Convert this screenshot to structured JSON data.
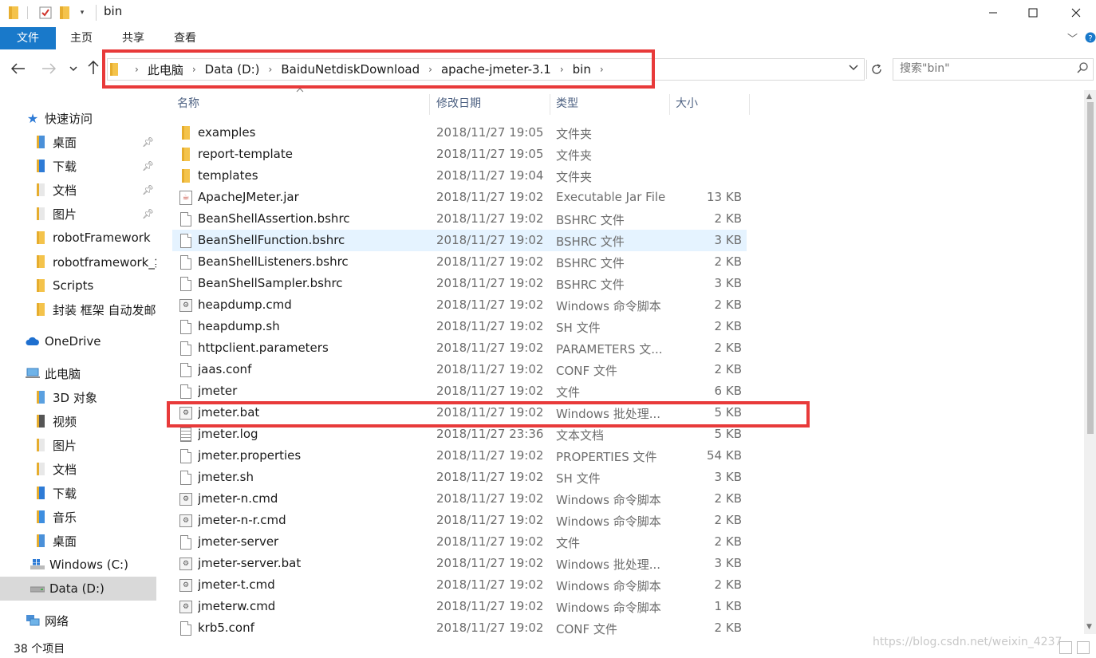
{
  "window": {
    "title": "bin",
    "minimize_icon": "minimize-icon",
    "maximize_icon": "maximize-icon",
    "close_icon": "close-icon"
  },
  "ribbon": {
    "tabs": [
      "文件",
      "主页",
      "共享",
      "查看"
    ],
    "accent_color": "#1979ca"
  },
  "address": {
    "crumbs": [
      "此电脑",
      "Data (D:)",
      "BaiduNetdiskDownload",
      "apache-jmeter-3.1",
      "bin"
    ]
  },
  "search": {
    "placeholder": "搜索\"bin\""
  },
  "sidebar": {
    "quick_access": {
      "label": "快速访问",
      "items": [
        {
          "label": "桌面",
          "pinned": true
        },
        {
          "label": "下载",
          "pinned": true
        },
        {
          "label": "文档",
          "pinned": true
        },
        {
          "label": "图片",
          "pinned": true
        },
        {
          "label": "robotFramework",
          "pinned": false
        },
        {
          "label": "robotframework_集",
          "pinned": false
        },
        {
          "label": "Scripts",
          "pinned": false
        },
        {
          "label": "封装 框架 自动发邮",
          "pinned": false
        }
      ]
    },
    "onedrive": {
      "label": "OneDrive"
    },
    "this_pc": {
      "label": "此电脑",
      "items": [
        {
          "label": "3D 对象"
        },
        {
          "label": "视频"
        },
        {
          "label": "图片"
        },
        {
          "label": "文档"
        },
        {
          "label": "下载"
        },
        {
          "label": "音乐"
        },
        {
          "label": "桌面"
        },
        {
          "label": "Windows (C:)"
        },
        {
          "label": "Data (D:)",
          "selected": true
        }
      ]
    },
    "network": {
      "label": "网络"
    }
  },
  "columns": {
    "name": "名称",
    "date": "修改日期",
    "type": "类型",
    "size": "大小"
  },
  "files": [
    {
      "name": "examples",
      "date": "2018/11/27 19:05",
      "type": "文件夹",
      "size": "",
      "icon": "folder"
    },
    {
      "name": "report-template",
      "date": "2018/11/27 19:05",
      "type": "文件夹",
      "size": "",
      "icon": "folder"
    },
    {
      "name": "templates",
      "date": "2018/11/27 19:04",
      "type": "文件夹",
      "size": "",
      "icon": "folder"
    },
    {
      "name": "ApacheJMeter.jar",
      "date": "2018/11/27 19:02",
      "type": "Executable Jar File",
      "size": "13 KB",
      "icon": "jar"
    },
    {
      "name": "BeanShellAssertion.bshrc",
      "date": "2018/11/27 19:02",
      "type": "BSHRC 文件",
      "size": "2 KB",
      "icon": "doc"
    },
    {
      "name": "BeanShellFunction.bshrc",
      "date": "2018/11/27 19:02",
      "type": "BSHRC 文件",
      "size": "3 KB",
      "icon": "doc",
      "hover": true
    },
    {
      "name": "BeanShellListeners.bshrc",
      "date": "2018/11/27 19:02",
      "type": "BSHRC 文件",
      "size": "2 KB",
      "icon": "doc"
    },
    {
      "name": "BeanShellSampler.bshrc",
      "date": "2018/11/27 19:02",
      "type": "BSHRC 文件",
      "size": "3 KB",
      "icon": "doc"
    },
    {
      "name": "heapdump.cmd",
      "date": "2018/11/27 19:02",
      "type": "Windows 命令脚本",
      "size": "2 KB",
      "icon": "cmd"
    },
    {
      "name": "heapdump.sh",
      "date": "2018/11/27 19:02",
      "type": "SH 文件",
      "size": "2 KB",
      "icon": "doc"
    },
    {
      "name": "httpclient.parameters",
      "date": "2018/11/27 19:02",
      "type": "PARAMETERS 文...",
      "size": "2 KB",
      "icon": "doc"
    },
    {
      "name": "jaas.conf",
      "date": "2018/11/27 19:02",
      "type": "CONF 文件",
      "size": "2 KB",
      "icon": "doc"
    },
    {
      "name": "jmeter",
      "date": "2018/11/27 19:02",
      "type": "文件",
      "size": "6 KB",
      "icon": "doc"
    },
    {
      "name": "jmeter.bat",
      "date": "2018/11/27 19:02",
      "type": "Windows 批处理...",
      "size": "5 KB",
      "icon": "cmd"
    },
    {
      "name": "jmeter.log",
      "date": "2018/11/27 23:36",
      "type": "文本文档",
      "size": "5 KB",
      "icon": "log"
    },
    {
      "name": "jmeter.properties",
      "date": "2018/11/27 19:02",
      "type": "PROPERTIES 文件",
      "size": "54 KB",
      "icon": "doc"
    },
    {
      "name": "jmeter.sh",
      "date": "2018/11/27 19:02",
      "type": "SH 文件",
      "size": "3 KB",
      "icon": "doc"
    },
    {
      "name": "jmeter-n.cmd",
      "date": "2018/11/27 19:02",
      "type": "Windows 命令脚本",
      "size": "2 KB",
      "icon": "cmd"
    },
    {
      "name": "jmeter-n-r.cmd",
      "date": "2018/11/27 19:02",
      "type": "Windows 命令脚本",
      "size": "2 KB",
      "icon": "cmd"
    },
    {
      "name": "jmeter-server",
      "date": "2018/11/27 19:02",
      "type": "文件",
      "size": "2 KB",
      "icon": "doc"
    },
    {
      "name": "jmeter-server.bat",
      "date": "2018/11/27 19:02",
      "type": "Windows 批处理...",
      "size": "3 KB",
      "icon": "cmd"
    },
    {
      "name": "jmeter-t.cmd",
      "date": "2018/11/27 19:02",
      "type": "Windows 命令脚本",
      "size": "2 KB",
      "icon": "cmd"
    },
    {
      "name": "jmeterw.cmd",
      "date": "2018/11/27 19:02",
      "type": "Windows 命令脚本",
      "size": "1 KB",
      "icon": "cmd"
    },
    {
      "name": "krb5.conf",
      "date": "2018/11/27 19:02",
      "type": "CONF 文件",
      "size": "2 KB",
      "icon": "doc"
    }
  ],
  "status": {
    "item_count": "38 个项目"
  },
  "watermark": "https://blog.csdn.net/weixin_4237",
  "highlight_color": "#e83a3a"
}
